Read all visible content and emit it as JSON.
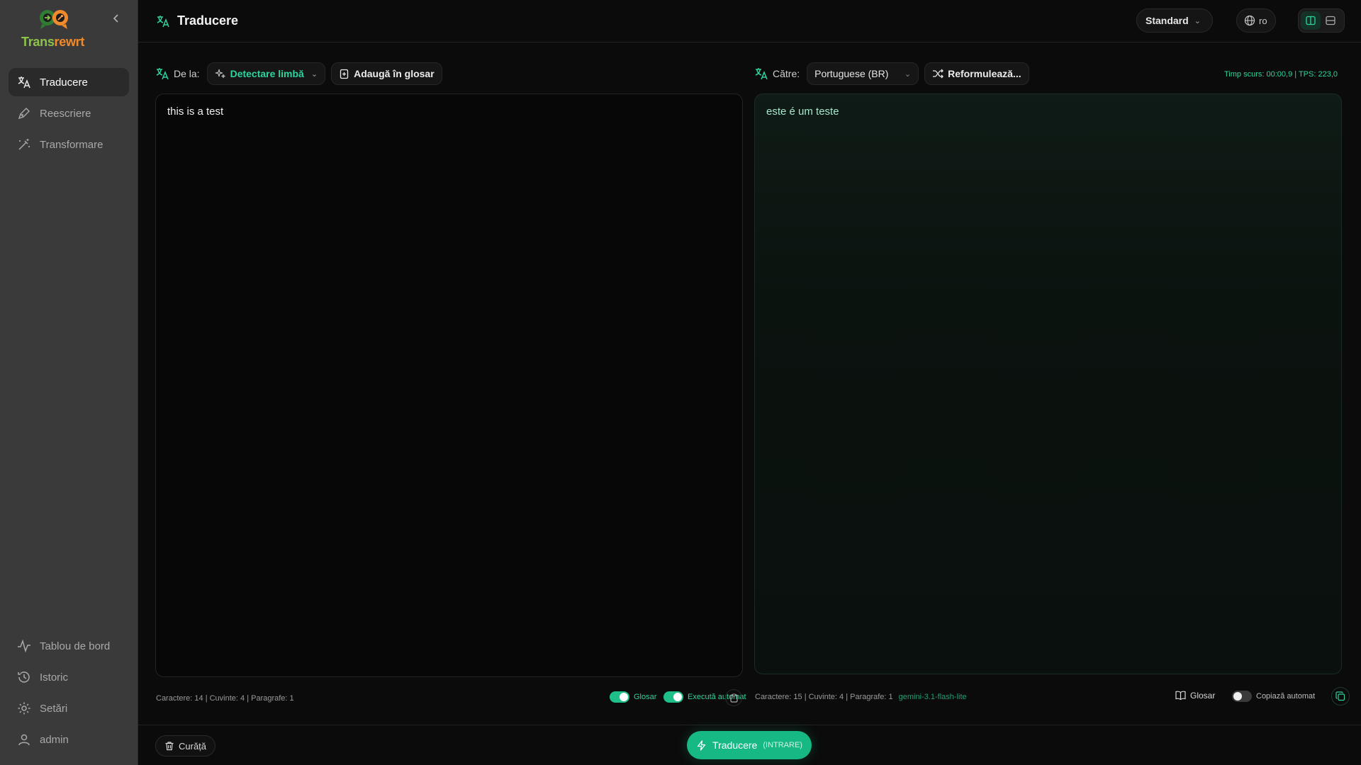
{
  "brand": {
    "name_part1": "Trans",
    "name_part2": "rewrt"
  },
  "sidebar": {
    "items": [
      {
        "label": "Traducere",
        "icon": "translate-icon",
        "active": true
      },
      {
        "label": "Reescriere",
        "icon": "pen-icon"
      },
      {
        "label": "Transformare",
        "icon": "wand-icon"
      }
    ],
    "bottom_items": [
      {
        "label": "Tablou de bord",
        "icon": "activity-icon"
      },
      {
        "label": "Istoric",
        "icon": "history-icon"
      },
      {
        "label": "Setări",
        "icon": "gear-icon"
      },
      {
        "label": "admin",
        "icon": "user-icon"
      }
    ]
  },
  "header": {
    "title": "Traducere",
    "mode": "Standard",
    "ui_lang": "ro"
  },
  "source": {
    "label": "De la:",
    "language": "Detectare limbă",
    "glossary_button": "Adaugă în glosar",
    "text": "this is a test",
    "stats": "Caractere: 14 | Cuvinte: 4 | Paragrafe: 1",
    "toggle_glossary": "Glosar",
    "toggle_autorun": "Execută automat"
  },
  "target": {
    "label": "Către:",
    "language": "Portuguese (BR)",
    "rephrase_button": "Reformulează...",
    "timing": "Timp scurs: 00:00,9 | TPS: 223,0",
    "text": "este é um teste",
    "stats": "Caractere: 15 | Cuvinte: 4 | Paragrafe: 1",
    "model": "gemini-3.1-flash-lite",
    "glossary_button": "Glosar",
    "toggle_autocopy": "Copiază automat"
  },
  "footer": {
    "clear_label": "Curăță",
    "translate_label": "Traducere",
    "translate_hint": "(INTRARE)"
  },
  "colors": {
    "accent": "#16b884",
    "accent_text": "#2fd3a0",
    "sidebar_bg": "#3a3a3a",
    "bg": "#0b0b0b"
  }
}
